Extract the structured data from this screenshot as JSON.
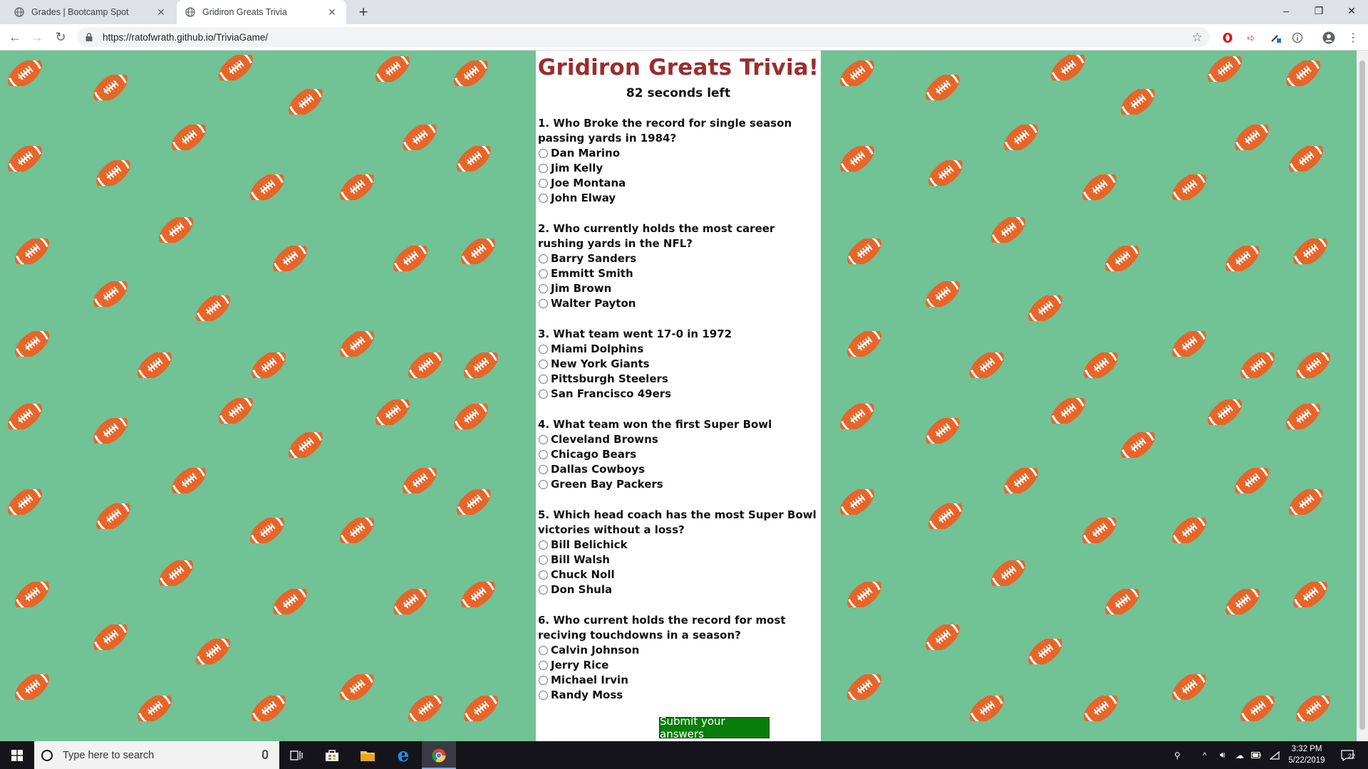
{
  "browser": {
    "tabs": [
      {
        "title": "Grades | Bootcamp Spot",
        "active": false
      },
      {
        "title": "Gridiron Greats Trivia",
        "active": true
      }
    ],
    "url": "https://ratofwrath.github.io/TriviaGame/"
  },
  "page": {
    "title": "Gridiron Greats Trivia!",
    "timer": "82 seconds left",
    "questions": [
      {
        "text": "1. Who Broke the record for single season passing yards in 1984?",
        "options": [
          "Dan Marino",
          "Jim Kelly",
          "Joe Montana",
          "John Elway"
        ]
      },
      {
        "text": "2. Who currently holds the most career rushing yards in the NFL?",
        "options": [
          "Barry Sanders",
          "Emmitt Smith",
          "Jim Brown",
          "Walter Payton"
        ]
      },
      {
        "text": "3. What team went 17-0 in 1972",
        "options": [
          "Miami Dolphins",
          "New York Giants",
          "Pittsburgh Steelers",
          "San Francisco 49ers"
        ]
      },
      {
        "text": "4. What team won the first Super Bowl",
        "options": [
          "Cleveland Browns",
          "Chicago Bears",
          "Dallas Cowboys",
          "Green Bay Packers"
        ]
      },
      {
        "text": "5. Which head coach has the most Super Bowl victories without a loss?",
        "options": [
          "Bill Belichick",
          "Bill Walsh",
          "Chuck Noll",
          "Don Shula"
        ]
      },
      {
        "text": "6. Who current holds the record for most reciving touchdowns in a season?",
        "options": [
          "Calvin Johnson",
          "Jerry Rice",
          "Michael Irvin",
          "Randy Moss"
        ]
      }
    ],
    "submit_label": "Submit your answers",
    "colors": {
      "background": "#71c295",
      "title": "#9b2d2d",
      "football": "#e8652a",
      "submit": "#0a7d0a"
    }
  },
  "taskbar": {
    "search_placeholder": "Type here to search",
    "time": "3:32 PM",
    "date": "5/22/2019",
    "notification_count": "22"
  }
}
